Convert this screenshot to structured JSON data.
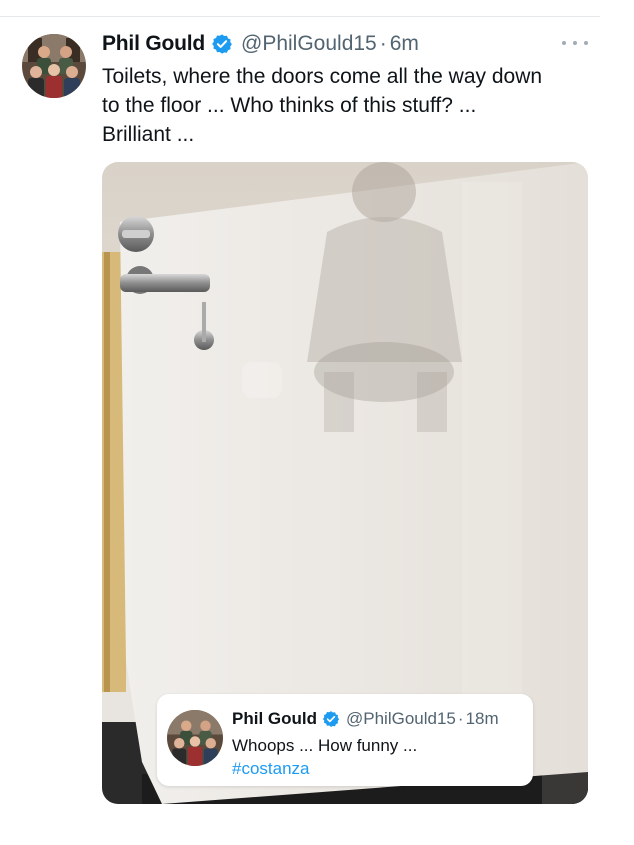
{
  "tweet": {
    "author_name": "Phil Gould",
    "handle": "@PhilGould15",
    "separator": "·",
    "time": "6m",
    "text_lines": [
      "Toilets, where the doors come all the way down",
      "to the floor ... Who thinks of this stuff? ...",
      "Brilliant ..."
    ],
    "verified": true,
    "more_icon": "more-horizontal-icon"
  },
  "quote": {
    "author_name": "Phil Gould",
    "handle": "@PhilGould15",
    "separator": "·",
    "time": "18m",
    "text": "Whoops ... How funny ...",
    "hashtag": "#costanza",
    "verified": true
  },
  "colors": {
    "text_primary": "#0f1419",
    "text_secondary": "#536471",
    "link": "#1d9bf0",
    "verified_badge": "#1d9bf0"
  }
}
